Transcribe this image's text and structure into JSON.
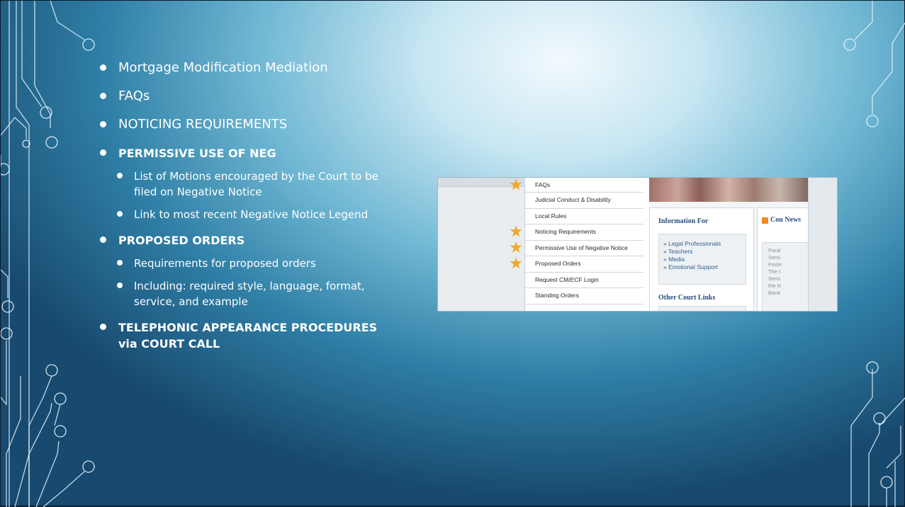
{
  "bullets": [
    {
      "text": "Mortgage Modification Mediation",
      "bold": false,
      "subitems": []
    },
    {
      "text": "FAQs",
      "bold": false,
      "subitems": []
    },
    {
      "text": "NOTICING REQUIREMENTS",
      "bold": false,
      "subitems": []
    },
    {
      "text": "PERMISSIVE USE OF NEG",
      "bold": true,
      "subitems": [
        "List of Motions encouraged by the Court to be filed on Negative Notice",
        "Link to most recent Negative Notice Legend"
      ]
    },
    {
      "text": "PROPOSED ORDERS",
      "bold": true,
      "subitems": [
        "Requirements for proposed orders",
        "Including:  required style, language, format, service, and example"
      ]
    },
    {
      "text": "TELEPHONIC APPEARANCE PROCEDURES via COURT CALL",
      "bold": true,
      "subitems": []
    }
  ],
  "screenshot": {
    "nav_items": [
      {
        "label": "FAQs",
        "starred": true
      },
      {
        "label": "Judicial Conduct & Disability",
        "starred": false
      },
      {
        "label": "Local Rules",
        "starred": false
      },
      {
        "label": "Noticing Requirements",
        "starred": true
      },
      {
        "label": "Permissive Use of Negative Notice",
        "starred": true
      },
      {
        "label": "Proposed Orders",
        "starred": true
      },
      {
        "label": "Request CM/ECF Login",
        "starred": false
      },
      {
        "label": "Standing Orders",
        "starred": false
      }
    ],
    "info_title": "Information For",
    "info_links": [
      "» Legal Professionals",
      "» Teachers",
      "» Media",
      "» Emotional Support"
    ],
    "other_title": "Other Court Links",
    "news_title": "Cou News",
    "news_lines": [
      "Paral",
      "Semi",
      "Poste",
      "The I",
      "Semi",
      "the N",
      "Bank"
    ]
  },
  "colors": {
    "accent_star": "#f0a825",
    "link": "#2f5f91",
    "heading": "#27507a"
  }
}
